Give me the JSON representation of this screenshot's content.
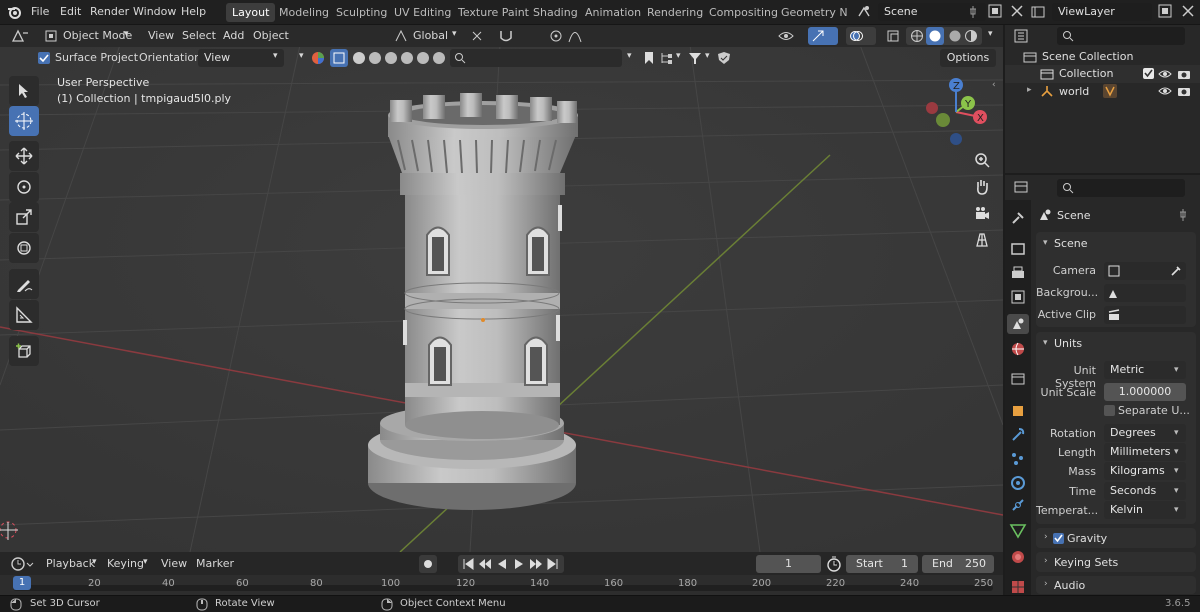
{
  "menu": {
    "blender_icon": "blender-logo-icon",
    "items": [
      "File",
      "Edit",
      "Render",
      "Window",
      "Help"
    ]
  },
  "workspaces": [
    "Layout",
    "Modeling",
    "Sculpting",
    "UV Editing",
    "Texture Paint",
    "Shading",
    "Animation",
    "Rendering",
    "Compositing",
    "Geometry Noc"
  ],
  "active_workspace": "Layout",
  "scene_field": "Scene",
  "view_layer_field": "ViewLayer",
  "viewport_header": {
    "mode": "Object Mode",
    "menus": [
      "View",
      "Select",
      "Add",
      "Object"
    ],
    "transform_orientation": "Global"
  },
  "tool_header": {
    "surface_project": "Surface Project",
    "orientation_label": "Orientation:",
    "orientation_value": "View",
    "options": "Options"
  },
  "viewport": {
    "perspective": "User Perspective",
    "collection_info": "(1) Collection | tmpigaud5l0.ply",
    "background": "#3a3a3a",
    "gizmo": {
      "x": "X",
      "y": "Y",
      "z": "Z"
    }
  },
  "outliner": {
    "scene_collection": "Scene Collection",
    "items": [
      {
        "label": "Collection"
      },
      {
        "label": "world"
      }
    ]
  },
  "properties": {
    "context": "Scene",
    "scene_panel": {
      "title": "Scene",
      "camera_label": "Camera",
      "background_label": "Backgrou...",
      "active_clip_label": "Active Clip"
    },
    "units_panel": {
      "title": "Units",
      "unit_system_label": "Unit System",
      "unit_system": "Metric",
      "unit_scale_label": "Unit Scale",
      "unit_scale": "1.000000",
      "separate_units": "Separate U...",
      "rotation_label": "Rotation",
      "rotation": "Degrees",
      "length_label": "Length",
      "length": "Millimeters",
      "mass_label": "Mass",
      "mass": "Kilograms",
      "time_label": "Time",
      "time": "Seconds",
      "temperature_label": "Temperat...",
      "temperature": "Kelvin"
    },
    "collapsed": [
      "Gravity",
      "Keying Sets",
      "Audio"
    ],
    "gravity_checked": true
  },
  "timeline": {
    "menus": [
      "Playback",
      "Keying",
      "View",
      "Marker"
    ],
    "current_frame": "1",
    "start_label": "Start",
    "start": "1",
    "end_label": "End",
    "end": "250",
    "ticks": [
      "1",
      "20",
      "40",
      "60",
      "80",
      "100",
      "120",
      "140",
      "160",
      "180",
      "200",
      "220",
      "240",
      "250"
    ]
  },
  "statusbar": {
    "left": "Set 3D Cursor",
    "middle": "Rotate View",
    "right_action": "Object Context Menu",
    "version": "3.6.5"
  },
  "colors": {
    "accent": "#4772b3",
    "x_axis": "#e04f5f",
    "y_axis": "#8bc34a",
    "z_axis": "#4a7fd0",
    "header": "#2a2a2a"
  }
}
